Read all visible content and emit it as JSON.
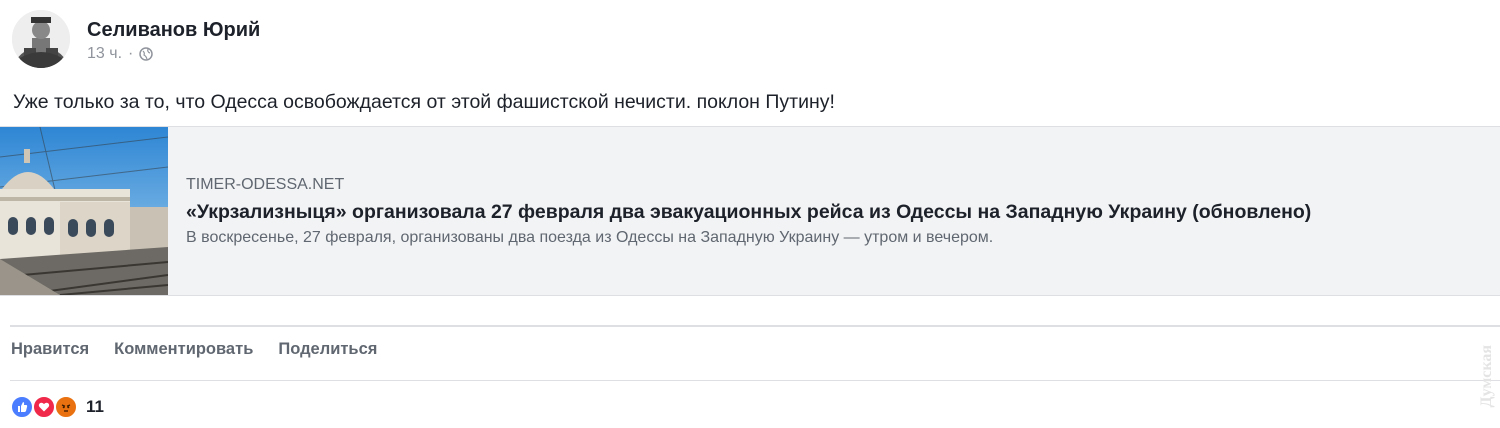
{
  "post": {
    "author": "Селиванов Юрий",
    "timestamp": "13 ч.",
    "separator": "·",
    "privacy_icon": "globe-icon",
    "text": "Уже только за то, что Одесса освобождается от этой фашистской нечисти. поклон Путину!"
  },
  "link_preview": {
    "domain": "TIMER-ODESSA.NET",
    "title": "«Укрзализныця» организовала 27 февраля два эвакуационных рейса из Одессы на Западную Украину (обновлено)",
    "description": "В воскресенье, 27 февраля, организованы два поезда из Одессы на Западную Украину — утром и вечером."
  },
  "actions": {
    "like": "Нравится",
    "comment": "Комментировать",
    "share": "Поделиться"
  },
  "reactions": {
    "icons": [
      "like-reaction-icon",
      "love-reaction-icon",
      "angry-reaction-icon"
    ],
    "count": "11"
  },
  "watermark": "Думская",
  "colors": {
    "like_blue": "#4a7dff",
    "love_red": "#f0284a",
    "angry_orange": "#e9710f",
    "link_bg": "#f2f3f5",
    "muted_text": "#606770"
  }
}
